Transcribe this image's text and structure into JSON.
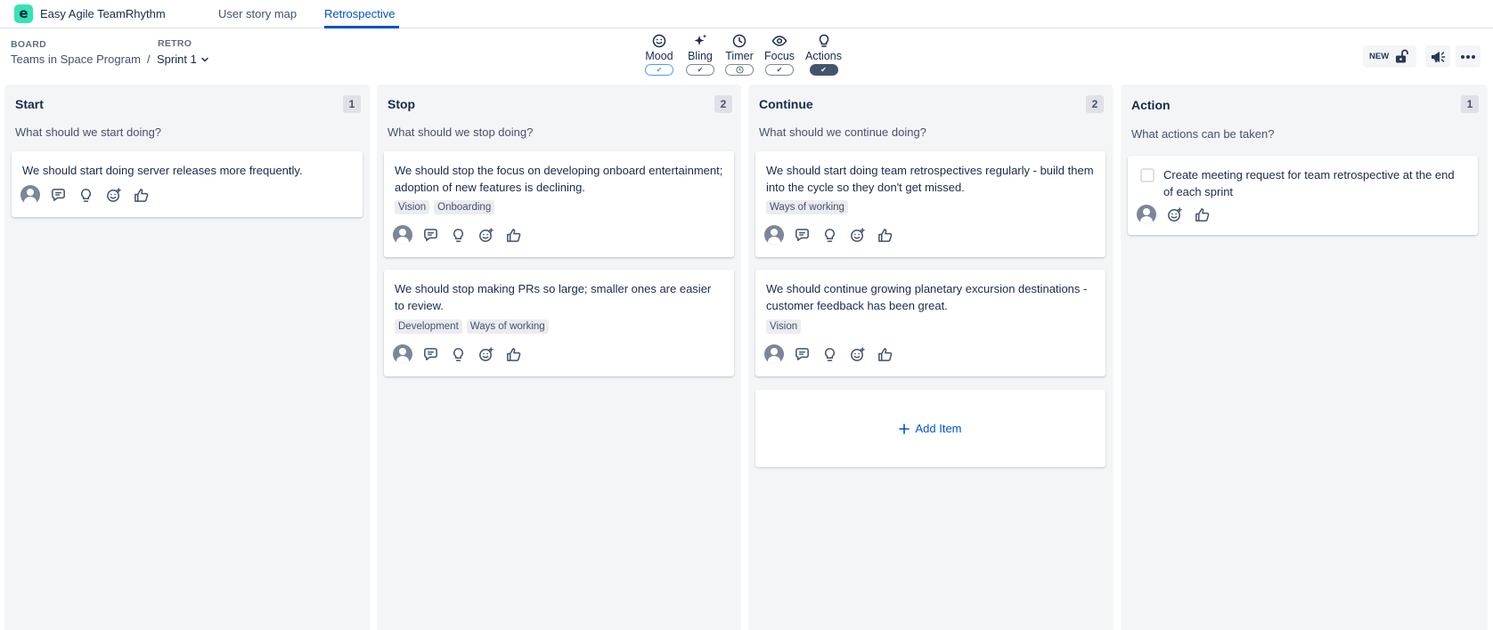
{
  "app": {
    "title": "Easy Agile TeamRhythm",
    "logo_letter": "e",
    "tabs": [
      {
        "label": "User story map",
        "active": false
      },
      {
        "label": "Retrospective",
        "active": true
      }
    ],
    "accent_color": "#0052cc"
  },
  "header": {
    "board_label": "BOARD",
    "board_value": "Teams in Space Program",
    "separator": "/",
    "retro_label": "RETRO",
    "retro_value": "Sprint 1",
    "tools": [
      {
        "label": "Mood",
        "icon": "mood-icon",
        "toggle": "blue"
      },
      {
        "label": "Bling",
        "icon": "sparkle-icon",
        "toggle": "on"
      },
      {
        "label": "Timer",
        "icon": "clock-icon",
        "toggle": "clock"
      },
      {
        "label": "Focus",
        "icon": "eye-icon",
        "toggle": "on"
      },
      {
        "label": "Actions",
        "icon": "lightbulb-icon",
        "toggle": "dark"
      }
    ],
    "new_badge": "NEW",
    "check_glyph": "✔"
  },
  "columns": [
    {
      "title": "Start",
      "count": "1",
      "prompt": "What should we start doing?",
      "cards": [
        {
          "text": "We should start doing server releases more frequently.",
          "tags": []
        }
      ]
    },
    {
      "title": "Stop",
      "count": "2",
      "prompt": "What should we stop doing?",
      "cards": [
        {
          "text": "We should stop the focus on developing onboard entertainment; adoption of new features is declining.",
          "tags": [
            "Vision",
            "Onboarding"
          ]
        },
        {
          "text": "We should stop making PRs so large; smaller ones are easier to review.",
          "tags": [
            "Development",
            "Ways of working"
          ]
        }
      ]
    },
    {
      "title": "Continue",
      "count": "2",
      "prompt": "What should we continue doing?",
      "cards": [
        {
          "text": "We should start doing team retrospectives regularly - build them into the cycle so they don't get missed.",
          "tags": [
            "Ways of working"
          ]
        },
        {
          "text": "We should continue growing planetary excursion destinations - customer feedback has been great.",
          "tags": [
            "Vision"
          ]
        }
      ],
      "add_item_label": "Add Item"
    },
    {
      "title": "Action",
      "count": "1",
      "prompt": "What actions can be taken?",
      "cards": [
        {
          "text": "Create meeting request for team retrospective at the end of each sprint",
          "tags": []
        }
      ]
    }
  ]
}
